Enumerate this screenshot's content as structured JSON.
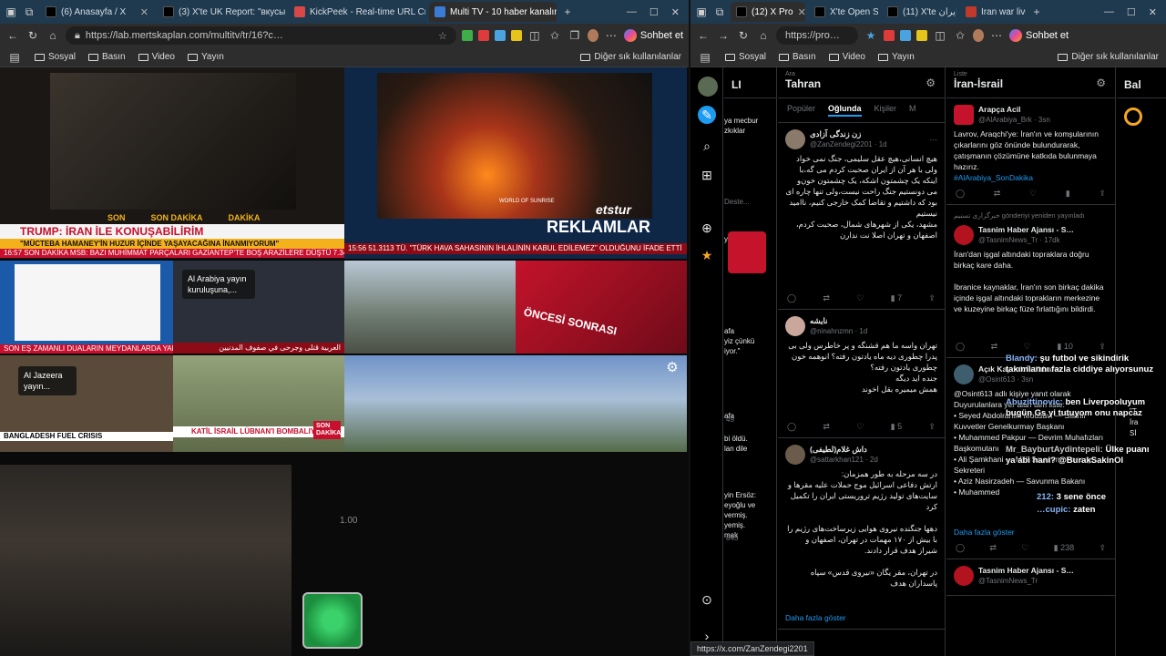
{
  "left_browser": {
    "tabs": [
      {
        "label": "(6) Anasayfa / X",
        "color": "#000000"
      },
      {
        "label": "(3) X'te UK Report: \"вкусы…",
        "color": "#000000"
      },
      {
        "label": "KickPeek - Real-time URL Cr…",
        "color": "#d94848"
      },
      {
        "label": "Multi TV - 10 haber kanalını…",
        "color": "#3a7bd5"
      }
    ],
    "url": "https://lab.mertskaplan.com/multitv/tr/16?c…",
    "sohbet_label": "Sohbet et",
    "bookmarks": [
      "Sosyal",
      "Basın",
      "Video",
      "Yayın"
    ],
    "bookmarks_other": "Diğer sık kullanılanlar"
  },
  "multitv": {
    "cell1": {
      "flash": [
        "SON",
        "SON DAKİKA",
        "DAKİKA"
      ],
      "headline": "TRUMP: İRAN İLE KONUŞABİLİRİM",
      "subheadline": "\"MÜCTEBA HAMANEY'İN HUZUR İÇİNDE YAŞAYACAĞINA İNANMIYORUM\"",
      "ticker": "16:57  SON DAKİKA  MSB: BAZI MUHİMMAT PARÇALARI GAZİANTEP'TE BOŞ ARAZİLERE DÜŞTÜ  7.340,69"
    },
    "cell2": {
      "brand": "etstur",
      "product": "WORLD OF SUNRISE",
      "ad_label": "REKLAMLAR",
      "ticker": "15:56  51.3113  TÜ. \"TÜRK HAVA SAHASININ İHLALİNİN KABUL EDİLEMEZ\" OLDUĞUNU İFADE ETTİ"
    },
    "cell3": {
      "ticker": "SON  EŞ ZAMANLI DUALARIN MEYDANLARDA YAPILMASI"
    },
    "cell4": {
      "overlay": "Al Arabiya yayın kuruluşuna,...",
      "ticker": "العربية  قتلى وجرحى في صفوف المدنيين"
    },
    "cell6": {
      "headline": "ÖNCESİ SONRASI"
    },
    "cell7": {
      "overlay": "Al Jazeera yayın...",
      "ticker": "BANGLADESH FUEL CRISIS"
    },
    "cell8": {
      "headline": "KATİL İSRAİL LÜBNAN'I BOMBALIYOR",
      "badge": "SON DAKİKA"
    },
    "speed_label": "1.00"
  },
  "right_browser": {
    "tabs": [
      {
        "label": "(12) X Pro",
        "color": "#000000"
      },
      {
        "label": "X'te Open S…",
        "color": "#000000"
      },
      {
        "label": "(11) X'te ایران…",
        "color": "#000000"
      },
      {
        "label": "Iran war live…",
        "color": "#c0392b"
      }
    ],
    "url": "https://pro…",
    "sohbet_label": "Sohbet et",
    "bookmarks": [
      "Sosyal",
      "Basın",
      "Video",
      "Yayın"
    ],
    "bookmarks_other": "Diğer sık kullanılanlar"
  },
  "xpro": {
    "col0": {
      "title": "LI",
      "snippets": [
        "Deste...",
        "ya mecbur",
        "zkıklar",
        "ying me...",
        "afa",
        "yiz çünkü",
        "iyor.\"",
        "afa",
        "bi öldü.",
        "lan dile",
        "yin Ersöz:",
        "eyoğlu ve",
        "vermiş.",
        "yemiş.",
        "mak"
      ],
      "counts": [
        "49",
        "845"
      ]
    },
    "col1": {
      "kind": "Ara",
      "title": "Tahran",
      "subtabs": [
        "Popüler",
        "Oğlunda",
        "Kişiler",
        "M"
      ],
      "tweets": [
        {
          "name": "زن زندگی آزادی",
          "handle": "@ZanZendegi2201 · 1d",
          "body": "هیچ انسانی،هیچ عقل سلیمی، جنگ نمی خواد\nولی با هر آن از ایران صحبت کردم می گه،با اینکه یک چشمتون اشکه، یک چشمتون خون‌و می دونستیم جنگ راحت نیست،ولی تنها چاره ای بود که داشتیم و تقاضا کمک خارجی کنیم، ناامید نیستیم\nمشهد، یکی از شهرهای شمال، صحبت کردم،\nاصفهان و تهران اصلا نت ندارن",
          "stats": "7"
        },
        {
          "name": "نایشه",
          "handle": "@ninahnzmn · 1d",
          "body": "تهران واسه ما هم قشنگه و پر خاطرس ولی بی پدرا چطوری دیه ماه یادتون رفته؟ انوهمه خون چطوری یادتون رفته؟\nجنده اید دیگه\nهمش میمیره بقل اخوند",
          "stats": "5"
        },
        {
          "name": "داش غلام(لطیفی)",
          "handle": "@sattarkhan121 · 2d",
          "body": "در سه مرحله به طور همزمان:\nارتش دفاعی اسرائیل موج حملات علیه مقرها و سایت‌های تولید رژیم تروریستی ایران را تکمیل کرد\n\nدهها جنگنده نیروی هوایی زیرساخت‌های رژیم را با بیش از ۱۷۰ مهمات در تهران، اصفهان و شیراز هدف قرار دادند.\n\nدر تهران، مقر یگان «نیروی قدس» سپاه پاسداران هدف",
          "more": "Daha fazla göster"
        }
      ]
    },
    "col2": {
      "kind": "Liste",
      "title": "İran-İsrail",
      "tweets": [
        {
          "name": "Arapça Acil",
          "handle": "@AlArabiya_Brk · 3sn",
          "body": "Lavrov, Araqchi'ye: İran'ın ve komşularının çıkarlarını göz önünde bulundurarak, çatışmanın çözümüne katkıda bulunmaya hazırız.",
          "link": "#AlArabiya_SonDakika"
        },
        {
          "repost": "خبرگزاری تسنیم gönderiyi yeniden yayınladı",
          "name": "Tasnim Haber Ajansı - S…",
          "handle": "@TasnimNews_Tr · 17dk",
          "body": "İran'dan işgal altındaki topraklara doğru birkaç kare daha.\n\nİbranice kaynaklar, İran'ın son birkaç dakika içinde işgal altındaki toprakların merkezine ve kuzeyine birkaç füze fırlattığını bildirdi.",
          "stats": "10"
        },
        {
          "name": "Açık Kaynak İstihbarat",
          "handle": "@Osint613 · 3sn",
          "body": "@Osint613 adlı kişiye yanıt olarak\nDuyurulanlara yer alan tam liste:\n• Seyed Abdolrahim Mousavi — Silahlı Kuvvetler Genelkurmay Başkanı\n• Muhammed Pakpur — Devrim Muhafızları Başkomutanı\n• Ali Şamkhani — Millî Savunma Konseyi Sekreteri\n• Aziz Nasirzadeh — Savunma Bakanı\n• Muhammed",
          "more": "Daha fazla göster",
          "stats": "238"
        },
        {
          "name": "Tasnim Haber Ajansı - S…",
          "handle": "@TasnimNews_Tr",
          "body": ""
        }
      ]
    },
    "col3": {
      "title": "Bal",
      "snippets": [
        "\"T",
        "İra",
        "Sİ"
      ]
    },
    "chat": [
      {
        "user": "Blandy:",
        "text": "şu futbol ve sikindirik takımlarını fazla ciddiye alıyorsunuz"
      },
      {
        "user": "Abuzittinovic:",
        "text": "ben Liverpooluyum bugün Gs yi tutuyom onu napcaz"
      },
      {
        "user": "Mr_BayburtAydintepeli:",
        "text": "Ülke puanı ya abi hani? @BurakSakinOl"
      },
      {
        "user": "212:",
        "text": "3 sene önce"
      },
      {
        "user": "…cupic:",
        "text": "zaten"
      }
    ],
    "status_url": "https://x.com/ZanZendegi2201"
  }
}
